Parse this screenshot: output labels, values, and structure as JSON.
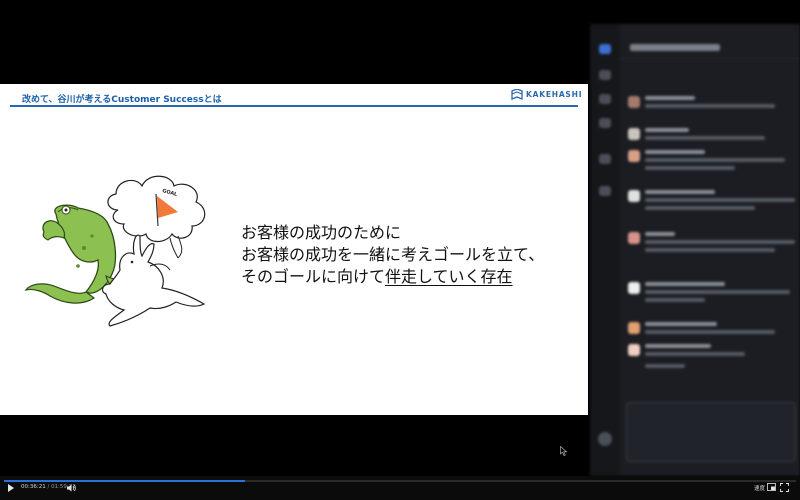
{
  "slide": {
    "title": "改めて、谷川が考えるCustomer Successとは",
    "logo_text": "KAKEHASHI",
    "goal_flag_text": "GOAL",
    "message_lines": [
      "お客様の成功のために",
      "お客様の成功を一緒に考えゴールを立て、",
      "そのゴールに向けて"
    ],
    "message_underlined": "伴走していく存在"
  },
  "player": {
    "current_time": "00:36:21",
    "separator": " / ",
    "duration": "01:59:33",
    "progress_fraction": 0.304,
    "speed_label": "速度",
    "accent_color": "#2f6fe0"
  },
  "chat_panel": {
    "state": "blurred",
    "background": "#1b1d22"
  },
  "colors": {
    "brand_blue": "#2b67ad",
    "frog_green": "#8cc152",
    "flag_orange": "#f07a3a"
  }
}
